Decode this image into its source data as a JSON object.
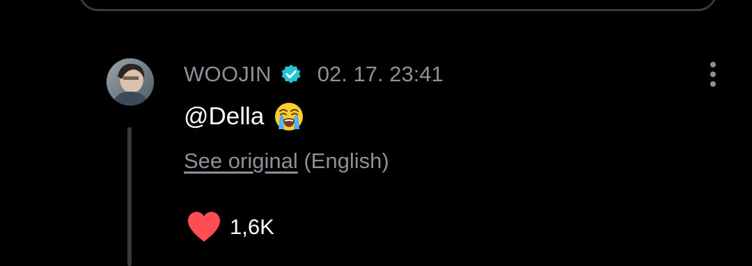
{
  "comment": {
    "username": "WOOJIN",
    "verified_icon": "verified-badge-icon",
    "timestamp": "02. 17. 23:41",
    "text": "@Della",
    "emoji": "loudly-crying-face",
    "see_original_label": "See original",
    "language_label": "(English)",
    "like_icon": "heart-icon",
    "like_count": "1,6K"
  },
  "colors": {
    "background": "#000000",
    "muted_text": "#8c9298",
    "verified": "#22c4d6",
    "heart": "#ff4d55"
  }
}
